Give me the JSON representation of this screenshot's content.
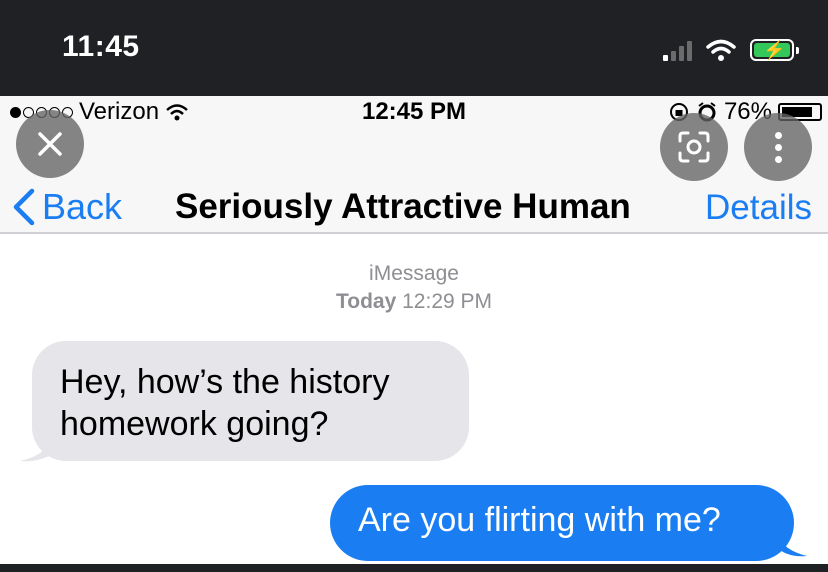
{
  "outer_status": {
    "time": "11:45",
    "icons": [
      "signal-icon",
      "wifi-icon",
      "battery-charging-icon"
    ]
  },
  "screenshot": {
    "status_bar": {
      "carrier": "Verizon",
      "time": "12:45 PM",
      "battery": "76%",
      "icons": [
        "signal-dots-icon",
        "wifi-icon",
        "rotation-lock-icon",
        "alarm-icon",
        "battery-icon"
      ]
    },
    "nav": {
      "back_label": "Back",
      "title": "Seriously Attractive Human",
      "details_label": "Details"
    },
    "thread": {
      "service": "iMessage",
      "date_prefix": "Today",
      "date_time": "12:29 PM"
    },
    "messages": [
      {
        "direction": "incoming",
        "line1": "Hey, how’s the history",
        "line2": "homework going?"
      },
      {
        "direction": "outgoing",
        "text": "Are you flirting with me?"
      }
    ]
  },
  "overlay": {
    "close": "close-icon",
    "lens": "lens-search-icon",
    "more": "more-vertical-icon"
  },
  "colors": {
    "ios_blue": "#1a7ef2",
    "incoming_bubble": "#e5e5ea",
    "battery_green": "#34c759",
    "dark_chrome": "#202124"
  }
}
